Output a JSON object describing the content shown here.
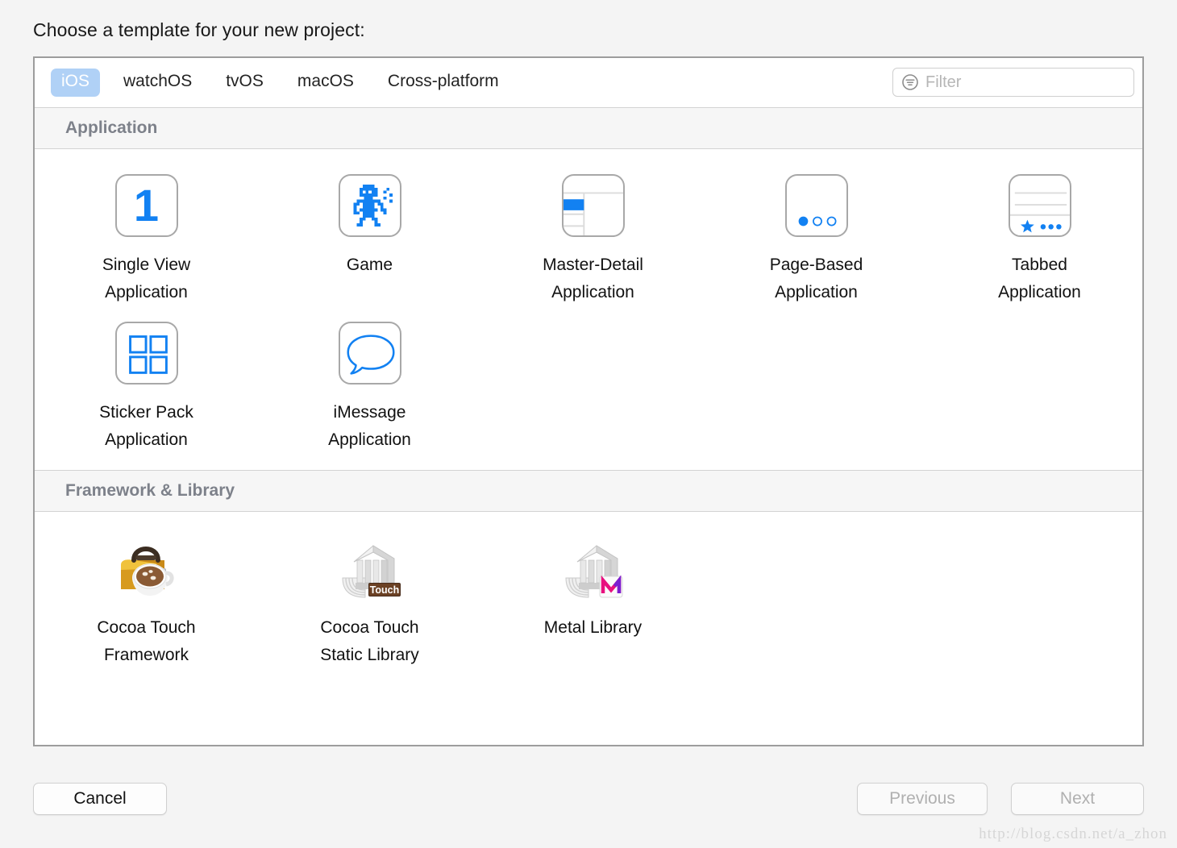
{
  "dialog": {
    "title": "Choose a template for your new project:"
  },
  "platform_tabs": [
    {
      "label": "iOS",
      "selected": true
    },
    {
      "label": "watchOS",
      "selected": false
    },
    {
      "label": "tvOS",
      "selected": false
    },
    {
      "label": "macOS",
      "selected": false
    },
    {
      "label": "Cross-platform",
      "selected": false
    }
  ],
  "filter": {
    "icon": "filter-circle-icon",
    "placeholder": "Filter",
    "value": ""
  },
  "sections": [
    {
      "header": "Application",
      "items": [
        {
          "label": "Single View\nApplication",
          "icon": "number-one-icon"
        },
        {
          "label": "Game",
          "icon": "pixel-robot-icon"
        },
        {
          "label": "Master-Detail\nApplication",
          "icon": "split-view-icon"
        },
        {
          "label": "Page-Based\nApplication",
          "icon": "page-dots-icon"
        },
        {
          "label": "Tabbed\nApplication",
          "icon": "tab-bar-icon"
        },
        {
          "label": "Sticker Pack\nApplication",
          "icon": "four-squares-icon"
        },
        {
          "label": "iMessage\nApplication",
          "icon": "speech-bubble-icon"
        }
      ]
    },
    {
      "header": "Framework & Library",
      "items": [
        {
          "label": "Cocoa Touch\nFramework",
          "icon": "toolbox-coffee-icon"
        },
        {
          "label": "Cocoa Touch\nStatic Library",
          "icon": "library-touch-icon",
          "badge": "Touch"
        },
        {
          "label": "Metal Library",
          "icon": "library-metal-icon",
          "badge": "M"
        }
      ]
    }
  ],
  "footer": {
    "cancel_label": "Cancel",
    "previous_label": "Previous",
    "next_label": "Next"
  },
  "watermark": "http://blog.csdn.net/a_zhon",
  "colors": {
    "accent_blue": "#1281f2",
    "tab_selected_bg": "#b0d1f6",
    "section_header_text": "#7d818a",
    "panel_border": "#9d9d9d",
    "metal_badge_pink": "#e8107f",
    "touch_badge_brown": "#5b3722"
  }
}
